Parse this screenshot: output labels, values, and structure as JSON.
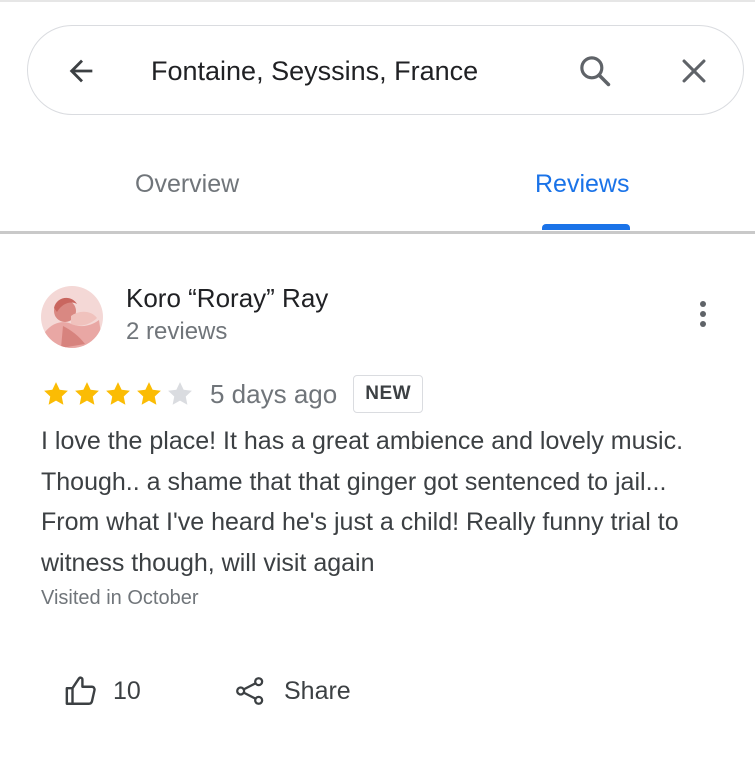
{
  "search": {
    "query": "Fontaine, Seyssins, France",
    "back_icon": "arrow-left-icon",
    "search_icon": "search-icon",
    "clear_icon": "close-icon"
  },
  "tabs": [
    {
      "label": "Overview",
      "active": false
    },
    {
      "label": "Reviews",
      "active": true
    }
  ],
  "review": {
    "author": "Koro “Roray” Ray",
    "author_meta": "2 reviews",
    "avatar": "avatar-illustration",
    "rating": 4,
    "rating_max": 5,
    "time": "5 days ago",
    "badge": "NEW",
    "text": "I love the place! It has a great ambience and lovely music. Though.. a shame that that ginger got sentenced to jail... From what I've heard he's just a child! Really funny trial to witness though, will visit again",
    "visited": "Visited in October",
    "likes": "10",
    "share_label": "Share"
  },
  "colors": {
    "accent": "#1a73e8",
    "star_filled": "#fbbc04",
    "star_empty": "#dadce0",
    "text_secondary": "#70757a"
  }
}
